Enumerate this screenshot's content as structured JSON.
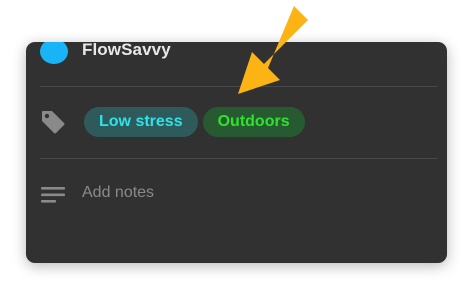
{
  "account": {
    "name": "FlowSavvy",
    "color": "#19b4f5"
  },
  "tags": {
    "icon": "tag-icon",
    "items": [
      {
        "label": "Low stress",
        "text_color": "#2ee2ea",
        "bg_color": "#2f5a5b"
      },
      {
        "label": "Outdoors",
        "text_color": "#2fe22f",
        "bg_color": "#285a32"
      }
    ]
  },
  "notes": {
    "icon": "notes-icon",
    "placeholder": "Add notes"
  },
  "annotation": {
    "icon": "arrow-icon",
    "color": "#fbb414"
  },
  "colors": {
    "card_background": "#313131",
    "divider": "#484848"
  }
}
